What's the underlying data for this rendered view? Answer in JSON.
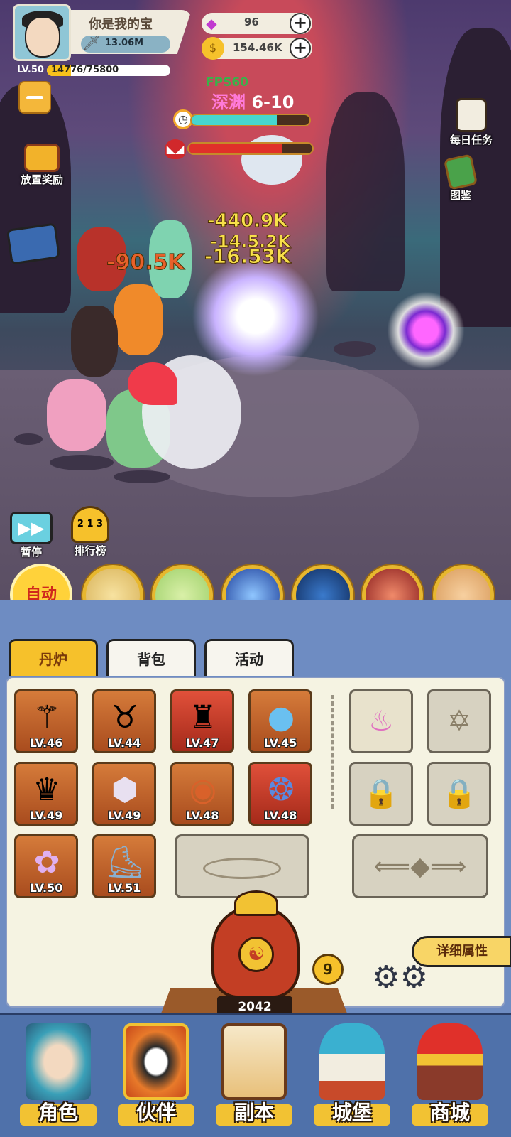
{
  "player": {
    "name": "你是我的宝",
    "power": "13.06M",
    "level_label": "LV.50",
    "xp_text": "14776/75800",
    "xp_fraction": 0.195
  },
  "resources": {
    "gems": "96",
    "gold": "154.46K"
  },
  "battle": {
    "fps": "FPS60",
    "stage_name": "深渊",
    "stage_number": "6-10",
    "timer_fraction": 0.72,
    "enemy_hp_fraction": 0.75,
    "damage_numbers": [
      "-440.9K",
      "-14.5.2K",
      "-16.53K",
      "-90.5K"
    ]
  },
  "side_buttons": {
    "daily_tasks": "每日任务",
    "codex": "图鉴",
    "idle_reward": "放置奖励",
    "pause": "暂停",
    "leaderboard": "排行榜",
    "leaderboard_ranks": [
      "2",
      "1",
      "3"
    ]
  },
  "skills": {
    "auto_label": "自动"
  },
  "tabs": [
    {
      "label": "丹炉"
    },
    {
      "label": "背包"
    },
    {
      "label": "活动"
    }
  ],
  "equipment": [
    {
      "level": "LV.46",
      "icon": "spear-icon"
    },
    {
      "level": "LV.44",
      "icon": "horned-helmet-icon"
    },
    {
      "level": "LV.47",
      "icon": "robe-icon"
    },
    {
      "level": "LV.45",
      "icon": "orb-icon"
    },
    {
      "level": "LV.49",
      "icon": "crown-icon"
    },
    {
      "level": "LV.49",
      "icon": "shield-icon"
    },
    {
      "level": "LV.48",
      "icon": "amulet-icon"
    },
    {
      "level": "LV.48",
      "icon": "gem-ring-icon"
    },
    {
      "level": "LV.50",
      "icon": "flower-ring-icon"
    },
    {
      "level": "LV.51",
      "icon": "boots-icon"
    }
  ],
  "furnace": {
    "detail_button": "详细属性",
    "count": "2042",
    "level": "9"
  },
  "bottom_nav": [
    {
      "label": "角色"
    },
    {
      "label": "伙伴"
    },
    {
      "label": "副本"
    },
    {
      "label": "城堡"
    },
    {
      "label": "商城"
    }
  ]
}
